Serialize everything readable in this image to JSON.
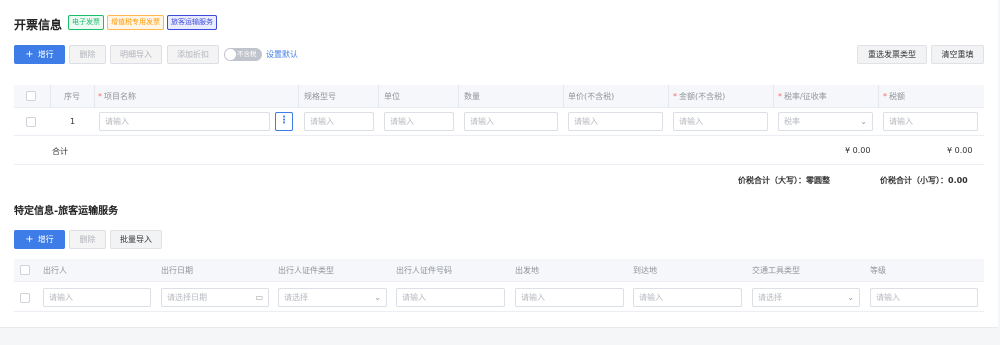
{
  "invoice": {
    "title": "开票信息",
    "tags": [
      {
        "label": "电子发票",
        "color": "#19be6b"
      },
      {
        "label": "增值税专用发票",
        "color": "#ff9900"
      },
      {
        "label": "旅客运输服务",
        "color": "#3e4bd9"
      }
    ],
    "toolbar": {
      "add": "增行",
      "delete": "删除",
      "import_detail": "明细导入",
      "add_discount": "添加折扣",
      "tax_toggle": "不含税",
      "set_default": "设置默认",
      "reselect_type": "重选发票类型",
      "clear_refill": "清空重填"
    },
    "columns": [
      "序号",
      "项目名称",
      "规格型号",
      "单位",
      "数量",
      "单价(不含税)",
      "金额(不含税)",
      "税率/征收率",
      "税额"
    ],
    "row": {
      "index": "1",
      "placeholder": "请输入",
      "tax_rate_placeholder": "税率"
    },
    "total": {
      "label": "合计",
      "amount": "¥ 0.00",
      "tax": "¥ 0.00"
    },
    "summary": {
      "upper_label": "价税合计（大写）：",
      "upper_value": "零圆整",
      "lower_label": "价税合计（小写）：",
      "lower_value": "0.00"
    }
  },
  "special": {
    "title": "特定信息-旅客运输服务",
    "toolbar": {
      "add": "增行",
      "delete": "删除",
      "batch_import": "批量导入"
    },
    "columns": [
      "出行人",
      "出行日期",
      "出行人证件类型",
      "出行人证件号码",
      "出发地",
      "到达地",
      "交通工具类型",
      "等级"
    ],
    "row": {
      "input": "请输入",
      "date": "请选择日期",
      "select": "请选择"
    }
  }
}
